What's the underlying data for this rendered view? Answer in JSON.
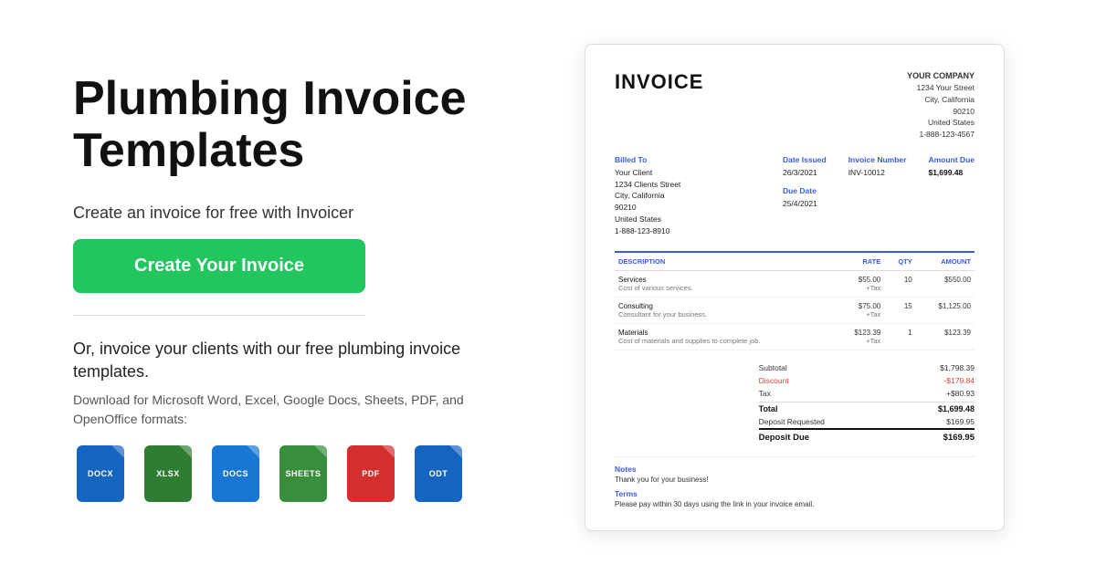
{
  "left": {
    "title_line1": "Plumbing Invoice",
    "title_line2": "Templates",
    "subtitle": "Create an invoice for free with Invoicer",
    "cta_label": "Create Your Invoice",
    "alt_text": "Or, invoice your clients with our free plumbing invoice templates.",
    "format_text": "Download for Microsoft Word, Excel, Google Docs, Sheets, PDF, and OpenOffice formats:",
    "file_formats": [
      {
        "label": "DOCX",
        "color_class": "docx-color"
      },
      {
        "label": "XLSX",
        "color_class": "xlsx-color"
      },
      {
        "label": "DOCS",
        "color_class": "gdocs-color"
      },
      {
        "label": "SHEETS",
        "color_class": "gsheets-color"
      },
      {
        "label": "PDF",
        "color_class": "pdf-color"
      },
      {
        "label": "ODT",
        "color_class": "odt-color"
      }
    ]
  },
  "invoice": {
    "title": "INVOICE",
    "company": {
      "name": "YOUR COMPANY",
      "address_line1": "1234 Your Street",
      "address_line2": "City, California",
      "address_line3": "90210",
      "address_line4": "United States",
      "phone": "1-888-123-4567"
    },
    "billed_to": {
      "label": "Billed To",
      "name": "Your Client",
      "address_line1": "1234 Clients Street",
      "address_line2": "City, California",
      "address_line3": "90210",
      "address_line4": "United States",
      "phone": "1-888-123-8910"
    },
    "date_issued_label": "Date Issued",
    "date_issued": "26/3/2021",
    "invoice_number_label": "Invoice Number",
    "invoice_number": "INV-10012",
    "amount_due_label": "Amount Due",
    "amount_due": "$1,699.48",
    "due_date_label": "Due Date",
    "due_date": "25/4/2021",
    "table_headers": {
      "description": "DESCRIPTION",
      "rate": "RATE",
      "qty": "QTY",
      "amount": "AMOUNT"
    },
    "line_items": [
      {
        "name": "Services",
        "desc": "Cost of various services.",
        "rate": "$55.00",
        "tax": "+Tax",
        "qty": "10",
        "amount": "$550.00"
      },
      {
        "name": "Consulting",
        "desc": "Consultant for your business.",
        "rate": "$75.00",
        "tax": "+Tax",
        "qty": "15",
        "amount": "$1,125.00"
      },
      {
        "name": "Materials",
        "desc": "Cost of materials and supplies to complete job.",
        "rate": "$123.39",
        "tax": "+Tax",
        "qty": "1",
        "amount": "$123.39"
      }
    ],
    "totals": {
      "subtotal_label": "Subtotal",
      "subtotal_value": "$1,798.39",
      "discount_label": "Discount",
      "discount_value": "-$179.84",
      "tax_label": "Tax",
      "tax_value": "+$80.93",
      "total_label": "Total",
      "total_value": "$1,699.48",
      "deposit_requested_label": "Deposit Requested",
      "deposit_requested_value": "$169.95",
      "deposit_due_label": "Deposit Due",
      "deposit_due_value": "$169.95"
    },
    "notes_label": "Notes",
    "notes_text": "Thank you for your business!",
    "terms_label": "Terms",
    "terms_text": "Please pay within 30 days using the link in your invoice email."
  }
}
